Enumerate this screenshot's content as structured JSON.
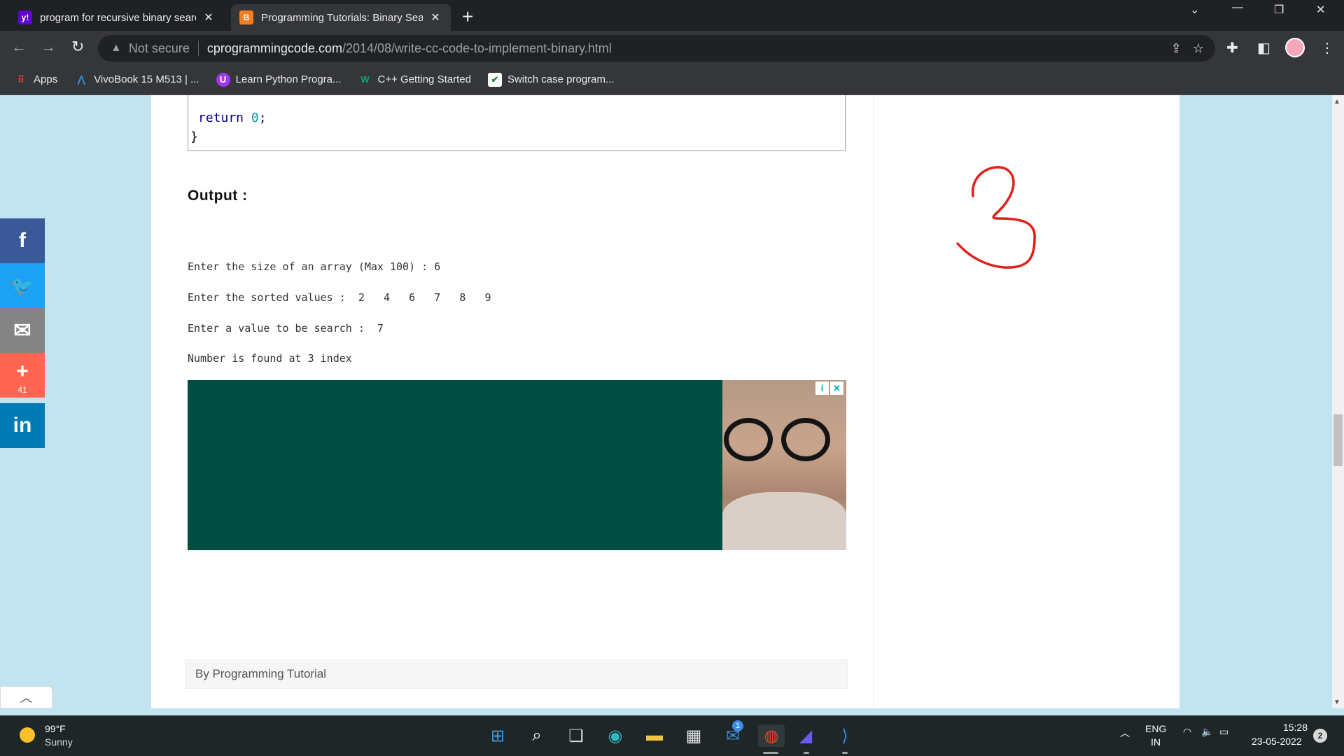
{
  "browser": {
    "tabs": [
      {
        "title": "program for recursive binary search",
        "favicon": "y!",
        "favicon_color": "#6001d2"
      },
      {
        "title": "Programming Tutorials: Binary Search",
        "favicon": "B",
        "favicon_color": "#f57c1f"
      }
    ],
    "address": {
      "security_label": "Not secure",
      "domain": "cprogrammingcode.com",
      "path": "/2014/08/write-cc-code-to-implement-binary.html"
    },
    "bookmarks": [
      {
        "label": "Apps",
        "icon": "apps-grid-icon"
      },
      {
        "label": "VivoBook 15 M513 | ...",
        "icon": "asus-icon"
      },
      {
        "label": "Learn Python Progra...",
        "icon": "udemy-icon"
      },
      {
        "label": "C++ Getting Started",
        "icon": "w3-icon"
      },
      {
        "label": "Switch case program...",
        "icon": "checkbox-icon"
      }
    ]
  },
  "article": {
    "code_tail": {
      "keyword": "return",
      "value": "0",
      "terminator": ";",
      "brace": "}"
    },
    "output_heading": "Output :",
    "output_lines": [
      "Enter the size of an array (Max 100) : 6",
      "Enter the sorted values :  2   4   6   7   8   9",
      "Enter a value to be search :  7",
      "Number is found at 3 index"
    ],
    "byline": "By Programming Tutorial",
    "ad_badges": {
      "info": "i",
      "close": "✕"
    }
  },
  "social": [
    {
      "name": "facebook",
      "glyph": "f",
      "color": "#3b5998",
      "count": ""
    },
    {
      "name": "twitter",
      "glyph": "🐦",
      "color": "#1da1f2",
      "count": ""
    },
    {
      "name": "email",
      "glyph": "✉",
      "color": "#848484",
      "count": ""
    },
    {
      "name": "more",
      "glyph": "+",
      "color": "#ff6550",
      "count": "41"
    },
    {
      "name": "linkedin",
      "glyph": "in",
      "color": "#007bb5",
      "count": ""
    }
  ],
  "taskbar": {
    "weather_temp": "99°F",
    "weather_desc": "Sunny",
    "language": "ENG",
    "region": "IN",
    "time": "15:28",
    "date": "23-05-2022",
    "notification_count": "2",
    "mail_badge": "1"
  }
}
